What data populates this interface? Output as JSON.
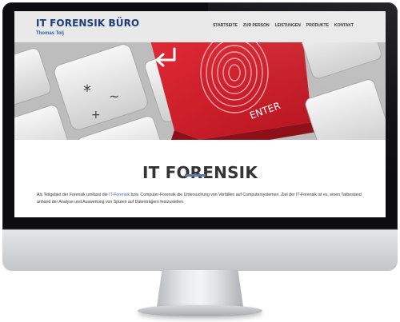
{
  "site": {
    "title": "IT FORENSIK BÜRO",
    "subtitle": "Thomas Tolj"
  },
  "nav": {
    "items": [
      {
        "label": "STARTSEITE"
      },
      {
        "label": "ZUR PERSON"
      },
      {
        "label": "LEISTUNGEN"
      },
      {
        "label": "PRODUKTE"
      },
      {
        "label": "KONTAKT"
      }
    ]
  },
  "hero": {
    "enter_key_label": "ENTER",
    "key_glyphs": [
      "*",
      "~",
      "+"
    ]
  },
  "main": {
    "title": "IT FORENSIK",
    "intro_before": "Als Teilgebiet der Forensik umfasst die ",
    "intro_link": "IT-Forensik",
    "intro_after": " bzw. Computer-Forensik die Untersuchung von Vorfällen auf Computersystemen. Ziel der IT-Forensik ist es, einen Tatbestand anhand der Analyse und Auswertung von Spuren auf Datenträgern festzustellen."
  },
  "colors": {
    "title_blue": "#1d3e78",
    "subtitle_blue": "#2a5db0",
    "accent_red": "#d41f2e",
    "underline_blue": "#5b79b3",
    "link_blue": "#2a6ec9"
  }
}
